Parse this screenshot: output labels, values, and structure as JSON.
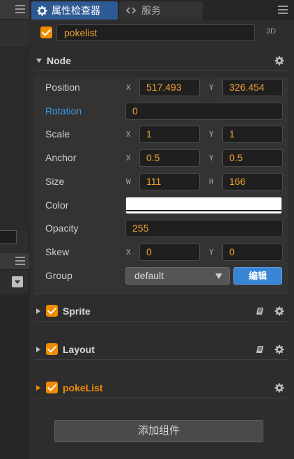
{
  "tabs": [
    {
      "label": "属性检查器",
      "icon": "gear-icon",
      "active": true
    },
    {
      "label": "服务",
      "icon": "link-icon",
      "active": false
    }
  ],
  "node": {
    "enabled": true,
    "name": "pokelist",
    "badge": "3D"
  },
  "sections": {
    "node": {
      "title": "Node",
      "expanded": true
    },
    "sprite": {
      "title": "Sprite",
      "expanded": false,
      "enabled": true
    },
    "layout": {
      "title": "Layout",
      "expanded": false,
      "enabled": true
    },
    "pokelist": {
      "title": "pokeList",
      "expanded": false,
      "enabled": true
    }
  },
  "props": {
    "position": {
      "label": "Position",
      "x_axis": "X",
      "x": "517.493",
      "y_axis": "Y",
      "y": "326.454"
    },
    "rotation": {
      "label": "Rotation",
      "value": "0"
    },
    "scale": {
      "label": "Scale",
      "x_axis": "X",
      "x": "1",
      "y_axis": "Y",
      "y": "1"
    },
    "anchor": {
      "label": "Anchor",
      "x_axis": "X",
      "x": "0.5",
      "y_axis": "Y",
      "y": "0.5"
    },
    "size": {
      "label": "Size",
      "w_axis": "W",
      "w": "111",
      "h_axis": "H",
      "h": "166"
    },
    "color": {
      "label": "Color",
      "value": "#ffffff"
    },
    "opacity": {
      "label": "Opacity",
      "value": "255"
    },
    "skew": {
      "label": "Skew",
      "x_axis": "X",
      "x": "0",
      "y_axis": "Y",
      "y": "0"
    },
    "group": {
      "label": "Group",
      "value": "default",
      "edit_label": "编辑"
    }
  },
  "add_component_label": "添加组件",
  "colors": {
    "accent": "#f08c00",
    "tab_active": "#2e5a94",
    "link_blue": "#3a9be6",
    "button_blue": "#3a84d6"
  }
}
